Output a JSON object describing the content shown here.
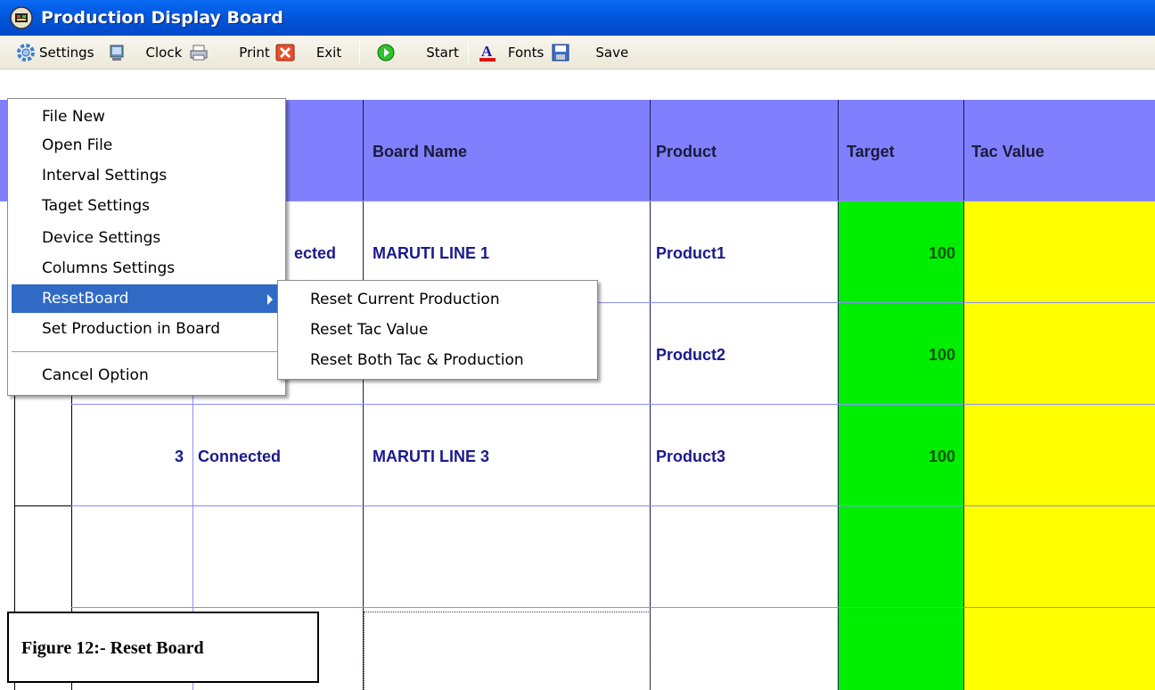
{
  "window": {
    "title": "Production Display Board"
  },
  "toolbar": {
    "settings_label": "Settings",
    "clock_label": "Clock",
    "print_label": "Print",
    "exit_label": "Exit",
    "start_label": "Start",
    "fonts_label": "Fonts",
    "save_label": "Save"
  },
  "grid": {
    "headers": {
      "board_name": "Board Name",
      "product": "Product",
      "target": "Target",
      "tac_value": "Tac Value"
    },
    "rows": [
      {
        "status": "ected",
        "board_name": "MARUTI LINE 1",
        "product": "Product1",
        "target": "100"
      },
      {
        "product": "Product2",
        "target": "100"
      },
      {
        "index": "3",
        "status": "Connected",
        "board_name": "MARUTI LINE 3",
        "product": "Product3",
        "target": "100"
      }
    ]
  },
  "settings_menu": {
    "items": [
      {
        "label": "File New"
      },
      {
        "label": "Open File"
      },
      {
        "label": "Interval Settings"
      },
      {
        "label": "Taget Settings"
      },
      {
        "label": "Device Settings"
      },
      {
        "label": "Columns Settings"
      },
      {
        "label": "ResetBoard"
      },
      {
        "label": "Set Production in Board"
      },
      {
        "label": "Cancel Option"
      }
    ]
  },
  "reset_submenu": {
    "items": [
      {
        "label": "Reset Current Production"
      },
      {
        "label": "Reset Tac Value"
      },
      {
        "label": "Reset Both Tac & Production"
      }
    ]
  },
  "figure": {
    "caption": "Figure 12:- Reset Board"
  },
  "colors": {
    "header_bg": "#8080ff",
    "target_bg": "#00ee00",
    "tac_bg": "#ffff00",
    "grid_line": "#8c8cff",
    "selected_menu": "#316ac5",
    "titlebar": "#0258e0"
  }
}
